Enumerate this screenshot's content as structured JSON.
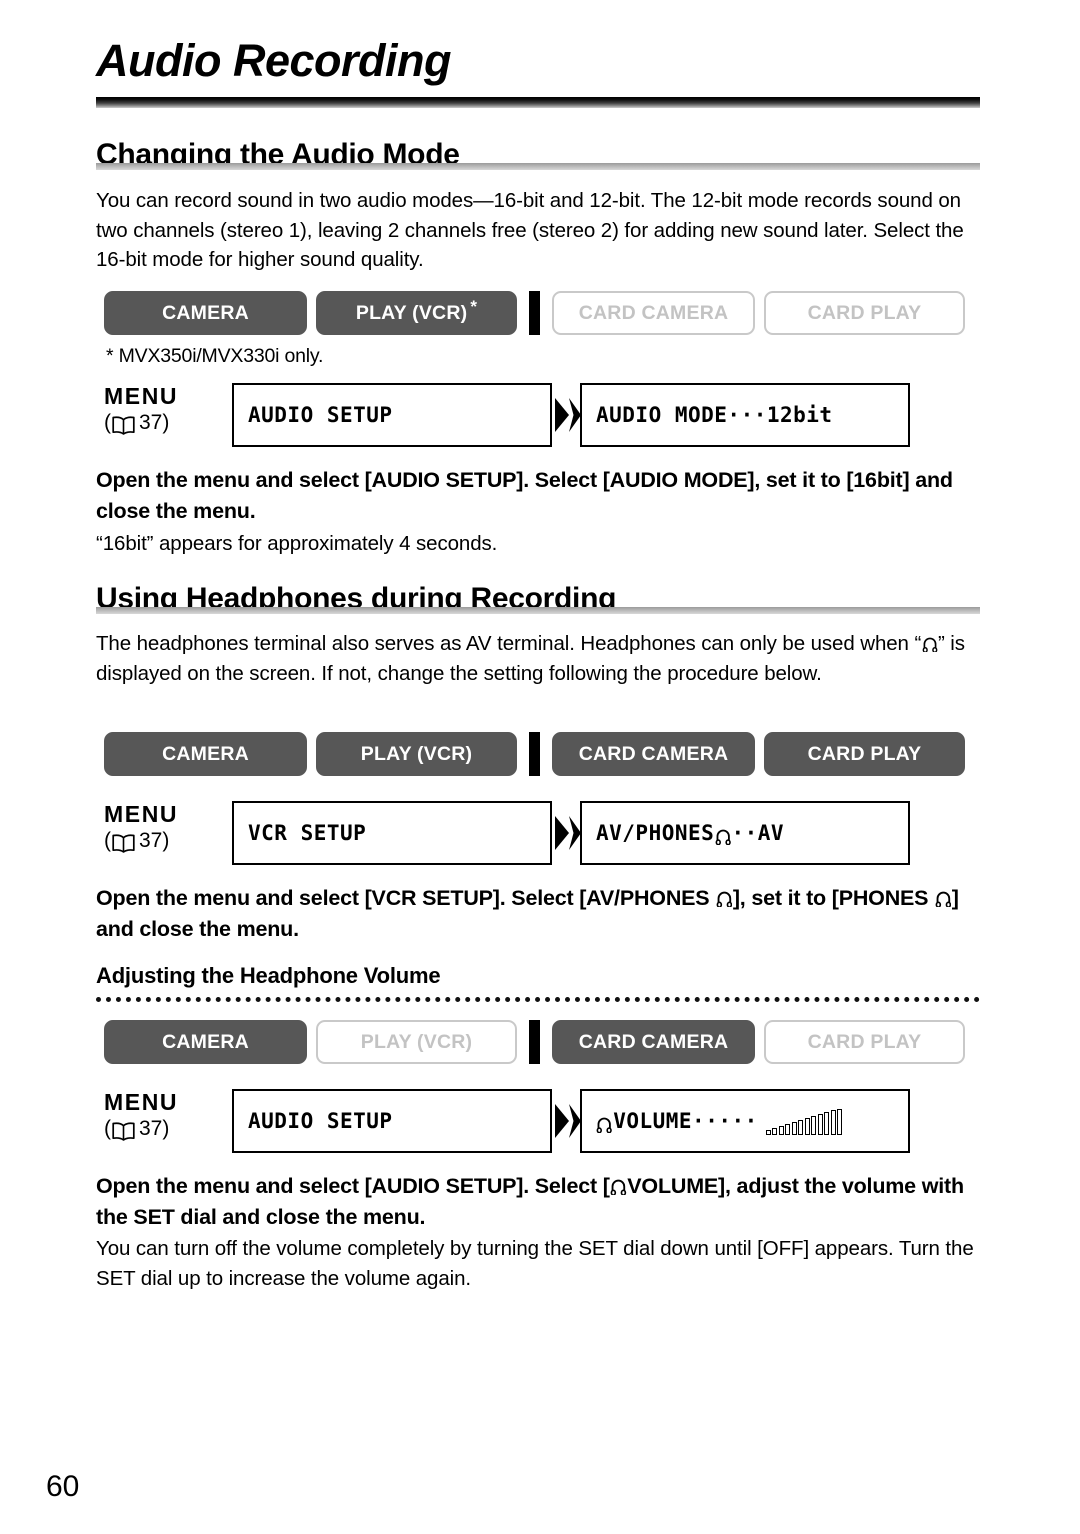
{
  "page": {
    "chapter_title": "Audio Recording",
    "page_number": "60"
  },
  "icons": {
    "book": "book-icon",
    "headphones": "headphones-icon",
    "volume_bars": "volume-level-icon",
    "arrow": "next-step-arrow-icon"
  },
  "sections": [
    {
      "heading": "Changing the Audio Mode",
      "body": "You can record sound in two audio modes—16-bit and 12-bit. The 12-bit mode records sound on two channels (stereo 1), leaving 2 channels free (stereo 2) for adding new sound later. Select the 16-bit mode for higher sound quality.",
      "modes": [
        {
          "label": "CAMERA",
          "active": true,
          "star": ""
        },
        {
          "label": "PLAY (VCR)",
          "active": true,
          "star": "*"
        },
        {
          "label": "CARD CAMERA",
          "active": false,
          "star": ""
        },
        {
          "label": "CARD PLAY",
          "active": false,
          "star": ""
        }
      ],
      "footnote": "* MVX350i/MVX330i only.",
      "menu": {
        "label": "MENU",
        "ref_open": "(",
        "ref_page": "37",
        "ref_close": ")",
        "box1": "AUDIO SETUP",
        "box2_pre": "AUDIO MODE···12bit",
        "box2_post": ""
      },
      "instruction": "Open the menu and select [AUDIO SETUP]. Select [AUDIO MODE], set it to [16bit] and close the menu.",
      "note": "“16bit” appears for approximately 4 seconds."
    },
    {
      "heading": "Using Headphones during Recording",
      "body_part1": "The headphones terminal also serves as AV terminal. Headphones can only be used when “",
      "body_part2": "” is displayed on the screen. If not, change the setting following the procedure below.",
      "modes": [
        {
          "label": "CAMERA",
          "active": true
        },
        {
          "label": "PLAY (VCR)",
          "active": true
        },
        {
          "label": "CARD CAMERA",
          "active": true
        },
        {
          "label": "CARD PLAY",
          "active": true
        }
      ],
      "menu": {
        "label": "MENU",
        "ref_open": "(",
        "ref_page": "37",
        "ref_close": ")",
        "box1": "VCR SETUP",
        "box2_pre": "AV/PHONES",
        "box2_post": "··AV"
      },
      "instruction_part1": "Open the menu and select [VCR SETUP]. Select [AV/PHONES ",
      "instruction_part2": "], set it to [PHONES ",
      "instruction_part3": "] and close the menu.",
      "subheading": "Adjusting the Headphone Volume"
    },
    {
      "modes": [
        {
          "label": "CAMERA",
          "active": true
        },
        {
          "label": "PLAY (VCR)",
          "active": false
        },
        {
          "label": "CARD CAMERA",
          "active": true
        },
        {
          "label": "CARD PLAY",
          "active": false
        }
      ],
      "menu": {
        "label": "MENU",
        "ref_open": "(",
        "ref_page": "37",
        "ref_close": ")",
        "box1": "AUDIO SETUP",
        "box2_pre": "VOLUME·····",
        "box2_post": ""
      },
      "instruction_part1": "Open the menu and select [AUDIO SETUP]. Select [",
      "instruction_part2": "VOLUME], adjust the volume with the SET dial and close the menu.",
      "note": "You can turn off the volume completely by turning the SET dial down until [OFF] appears. Turn the SET dial up to increase the volume again."
    }
  ],
  "colors": {
    "active_button_bg": "#575757",
    "active_button_text": "#ffffff",
    "inactive_button_border": "#c9c9c9",
    "inactive_button_text": "#c3c3c3",
    "rule_dark": "#000000"
  }
}
